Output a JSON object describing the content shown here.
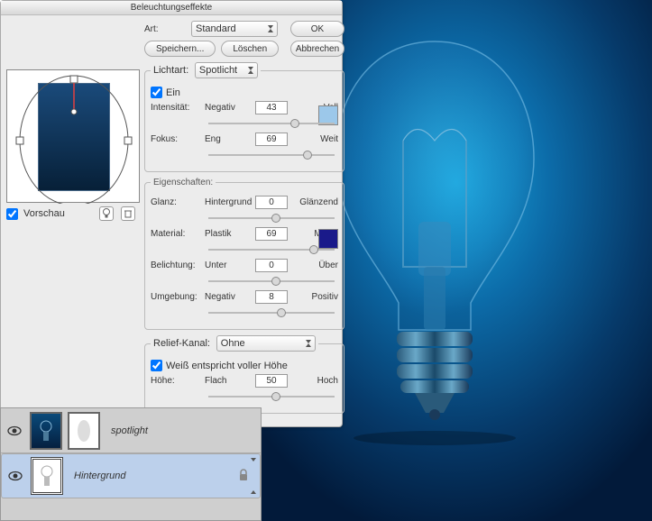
{
  "dialog": {
    "title": "Beleuchtungseffekte",
    "art_label": "Art:",
    "art_value": "Standard",
    "ok": "OK",
    "cancel": "Abbrechen",
    "save": "Speichern...",
    "delete": "Löschen"
  },
  "lichtart": {
    "legend": "Lichtart:",
    "value": "Spotlicht",
    "ein": "Ein",
    "intensitaet": {
      "label": "Intensität:",
      "left": "Negativ",
      "value": "43",
      "right": "Voll",
      "pos": 65
    },
    "fokus": {
      "label": "Fokus:",
      "left": "Eng",
      "value": "69",
      "right": "Weit",
      "pos": 75
    },
    "swatch": "#9cc8ea"
  },
  "eigenschaften": {
    "legend": "Eigenschaften:",
    "glanz": {
      "label": "Glanz:",
      "left": "Hintergrund",
      "value": "0",
      "right": "Glänzend",
      "pos": 50
    },
    "material": {
      "label": "Material:",
      "left": "Plastik",
      "value": "69",
      "right": "Metall",
      "pos": 80
    },
    "belichtung": {
      "label": "Belichtung:",
      "left": "Unter",
      "value": "0",
      "right": "Über",
      "pos": 50
    },
    "umgebung": {
      "label": "Umgebung:",
      "left": "Negativ",
      "value": "8",
      "right": "Positiv",
      "pos": 54
    },
    "swatch": "#1a1a8a"
  },
  "relief": {
    "legend": "Relief-Kanal:",
    "value": "Ohne",
    "weiss": "Weiß entspricht voller Höhe",
    "hoehe": {
      "label": "Höhe:",
      "left": "Flach",
      "value": "50",
      "right": "Hoch",
      "pos": 50
    }
  },
  "preview": {
    "label": "Vorschau"
  },
  "layers": {
    "row1": {
      "name": "spotlight"
    },
    "row2": {
      "name": "Hintergrund"
    }
  }
}
